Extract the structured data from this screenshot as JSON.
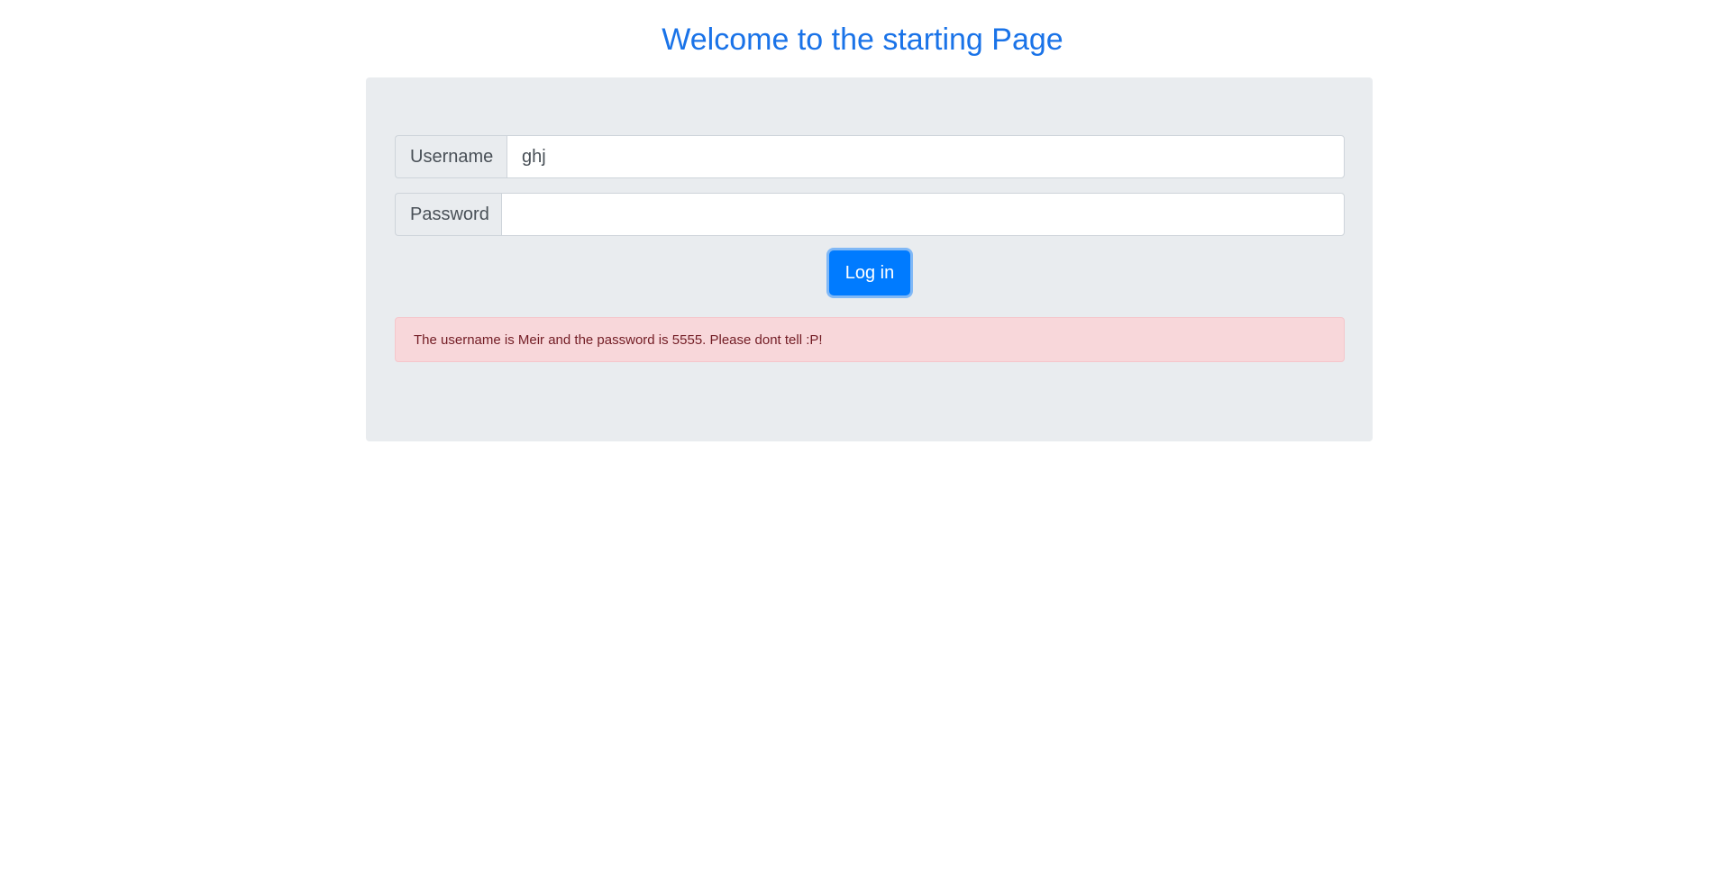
{
  "header": {
    "title": "Welcome to the starting Page"
  },
  "login_form": {
    "username": {
      "label": "Username",
      "value": "ghj",
      "placeholder": ""
    },
    "password": {
      "label": "Password",
      "value": "",
      "placeholder": ""
    },
    "login_label": "Log in"
  },
  "alert": {
    "message": "The username is Meir and the password is 5555. Please dont tell :P!"
  },
  "colors": {
    "title": "#1a73e8",
    "button": "#007bff",
    "panel_bg": "#e9ecef",
    "alert_bg": "#f8d7da",
    "alert_text": "#721c24"
  }
}
